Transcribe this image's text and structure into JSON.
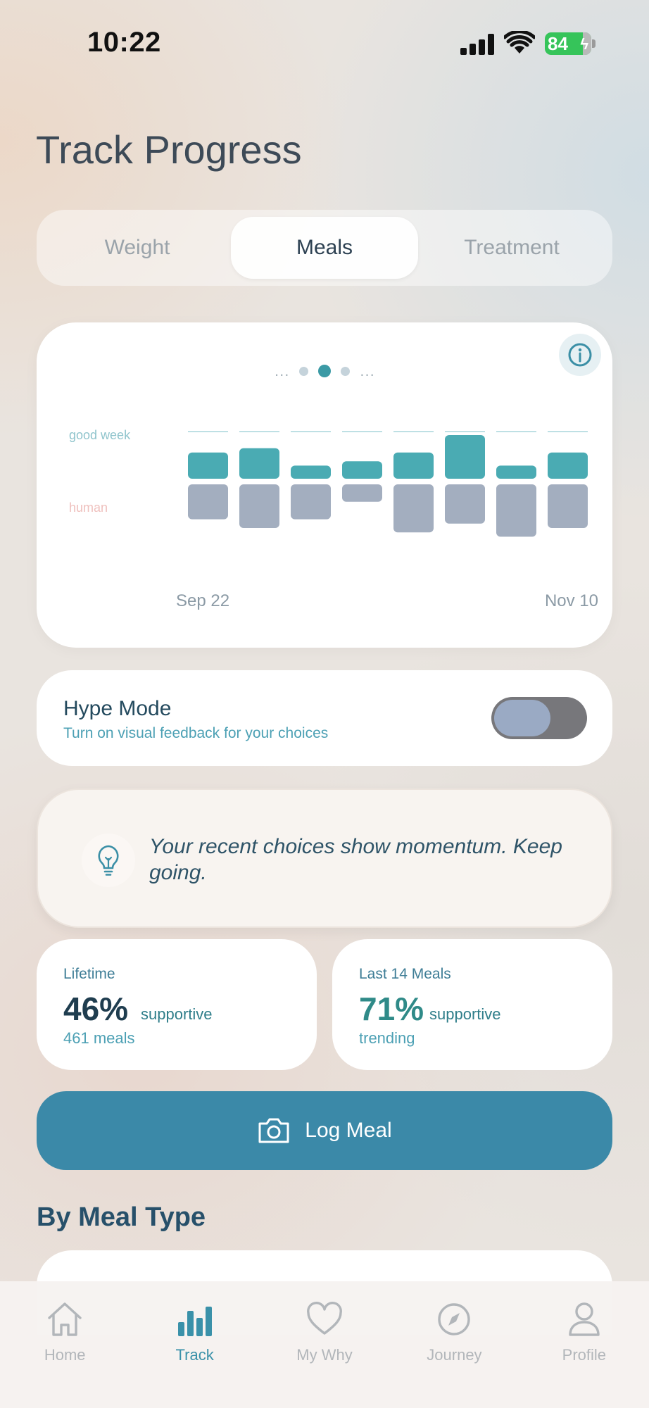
{
  "status_bar": {
    "time": "10:22",
    "battery": "84"
  },
  "page": {
    "title": "Track Progress"
  },
  "tabs": [
    {
      "label": "Weight",
      "active": false
    },
    {
      "label": "Meals",
      "active": true
    },
    {
      "label": "Treatment",
      "active": false
    }
  ],
  "chart": {
    "pager": {
      "ellipsis": "...",
      "pages": 3,
      "active_index": 1
    },
    "label_good": "good week",
    "label_human": "human",
    "date_start": "Sep 22",
    "date_end": "Nov 10"
  },
  "chart_data": {
    "type": "bar",
    "categories_count": 8,
    "series": [
      {
        "values": [
          3,
          3.5,
          1.5,
          2,
          3,
          5,
          1.5,
          3
        ]
      },
      {
        "values": [
          4,
          5,
          4,
          2,
          5.5,
          4.5,
          6,
          5
        ]
      }
    ],
    "colors": {
      "supportive": "#4aabb3",
      "human": "#a3aebf"
    }
  },
  "hype": {
    "title": "Hype Mode",
    "subtitle": "Turn on visual feedback for your choices",
    "enabled": false
  },
  "insight": {
    "icon": "lightbulb-icon",
    "text": "Your recent choices show momentum. Keep going."
  },
  "stats": {
    "lifetime": {
      "label": "Lifetime",
      "value": "46%",
      "unit": "supportive",
      "sub": "461 meals"
    },
    "last14": {
      "label": "Last 14 Meals",
      "value": "71%",
      "unit": "supportive",
      "sub": "trending"
    }
  },
  "log_button": {
    "label": "Log Meal",
    "icon": "camera-icon"
  },
  "section": {
    "title": "By Meal Type"
  },
  "nav": [
    {
      "label": "Home",
      "icon": "home-icon",
      "active": false
    },
    {
      "label": "Track",
      "icon": "bar-chart-icon",
      "active": true
    },
    {
      "label": "My Why",
      "icon": "heart-icon",
      "active": false
    },
    {
      "label": "Journey",
      "icon": "compass-icon",
      "active": false
    },
    {
      "label": "Profile",
      "icon": "person-icon",
      "active": false
    }
  ],
  "colors": {
    "accent": "#3b89a8",
    "teal": "#4aabb3",
    "muted_bar": "#a3aebf"
  }
}
